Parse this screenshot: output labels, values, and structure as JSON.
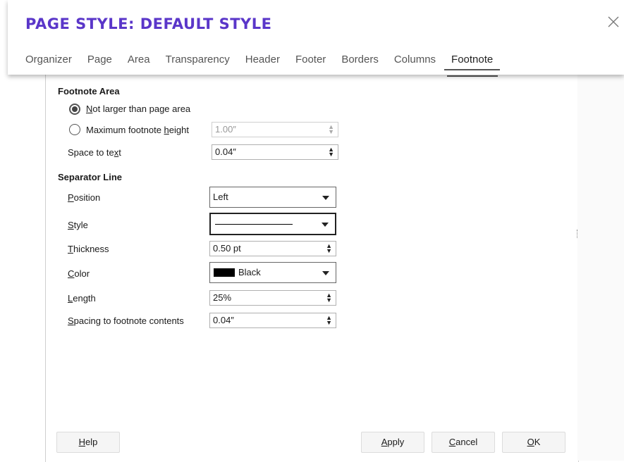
{
  "dialog": {
    "title": "PAGE STYLE: DEFAULT STYLE",
    "tabs": [
      "Organizer",
      "Page",
      "Area",
      "Transparency",
      "Header",
      "Footer",
      "Borders",
      "Columns",
      "Footnote"
    ],
    "active_tab": "Footnote"
  },
  "footnote_area": {
    "heading": "Footnote Area",
    "option_not_larger": "Not larger than page area",
    "option_max_height": "Maximum footnote height",
    "max_height_value": "1.00″",
    "space_to_text_label": "Space to text",
    "space_to_text_value": "0.04″"
  },
  "separator_line": {
    "heading": "Separator Line",
    "position_label": "Position",
    "position_value": "Left",
    "style_label": "Style",
    "thickness_label": "Thickness",
    "thickness_value": "0.50 pt",
    "color_label": "Color",
    "color_value": "Black",
    "color_swatch": "#000000",
    "length_label": "Length",
    "length_value": "25%",
    "spacing_label": "Spacing to footnote contents",
    "spacing_value": "0.04″"
  },
  "buttons": {
    "help": "Help",
    "apply": "Apply",
    "cancel": "Cancel",
    "ok": "OK"
  },
  "colors": {
    "title": "#5a36c9"
  }
}
